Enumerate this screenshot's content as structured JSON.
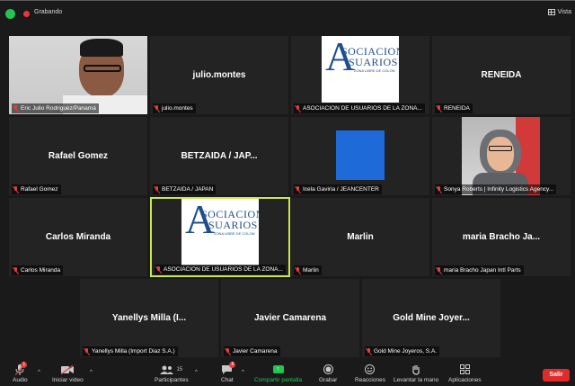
{
  "topbar": {
    "recording_label": "Grabando",
    "view_label": "Vista"
  },
  "tiles": [
    {
      "display": "",
      "label": "Eric Julio Rodriguez/Panamá"
    },
    {
      "display": "julio.montes",
      "label": "julio.montes"
    },
    {
      "display": "",
      "label": "ASOCIACION DE USUARIOS DE LA ZONA..."
    },
    {
      "display": "RENEIDA",
      "label": "RENEIDA"
    },
    {
      "display": "Rafael Gomez",
      "label": "Rafael Gomez"
    },
    {
      "display": "BETZAIDA / JAP...",
      "label": "BETZAIDA / JAPAN"
    },
    {
      "display": "",
      "label": "Icela Gaviria / JEANCENTER"
    },
    {
      "display": "",
      "label": "Sonya Roberts | Infinity Logistics Agency..."
    },
    {
      "display": "Carlos Miranda",
      "label": "Carlos Miranda"
    },
    {
      "display": "",
      "label": "ASOCIACION DE USUARIOS DE LA ZONA..."
    },
    {
      "display": "Marlin",
      "label": "Marlin"
    },
    {
      "display": "maria Bracho Ja...",
      "label": "maria Bracho Japan Intl Parts"
    },
    {
      "display": "Yanellys Milla (I...",
      "label": "Yanellys Milla (Import Diaz S.A.)"
    },
    {
      "display": "Javier Camarena",
      "label": "Javier Camarena"
    },
    {
      "display": "Gold Mine Joyer...",
      "label": "Gold Mine Joyeros, S.A."
    }
  ],
  "logo": {
    "line1": "SOCIACION",
    "line2": "SUARIOS",
    "line3": "ZONA LIBRE DE COLON"
  },
  "toolbar": {
    "audio": "Audio",
    "audio_badge": "1",
    "video": "Iniciar video",
    "participants": "Participantes",
    "participants_count": "15",
    "chat": "Chat",
    "chat_badge": "8",
    "share": "Compartir pantalla",
    "record": "Grabar",
    "reactions": "Reacciones",
    "raise_hand": "Levantar la mano",
    "apps": "Aplicaciones",
    "leave": "Salir"
  },
  "colors": {
    "accent_green": "#23c552",
    "leave_red": "#e02b2b",
    "active_speaker": "#c8e84d",
    "logo_blue": "#1f4e8c"
  }
}
